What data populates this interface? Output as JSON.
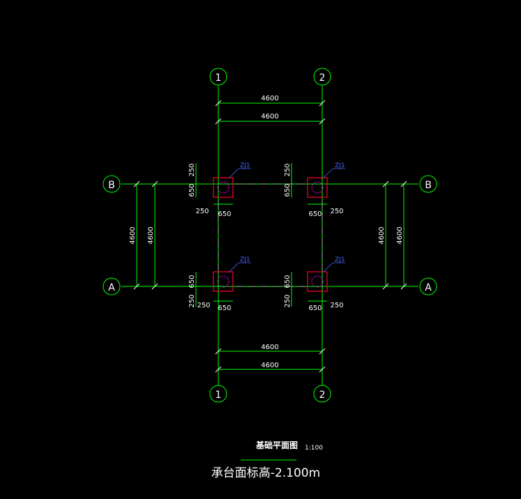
{
  "drawing": {
    "title": "基础平面图",
    "scale": "1:100",
    "subtitle": "承台面标高-2.100m",
    "colors": {
      "background": "#000000",
      "axis_line": "#00ff00",
      "grid_line": "#ffffff",
      "dimension": "#ffffff",
      "cap_outline": "#ff0033",
      "pile": "#ff00ff",
      "pile_label": "#4a6bff"
    }
  },
  "axes": {
    "columns": [
      {
        "id": "col-1",
        "label": "1"
      },
      {
        "id": "col-2",
        "label": "2"
      }
    ],
    "rows": [
      {
        "id": "row-B",
        "label": "B"
      },
      {
        "id": "row-A",
        "label": "A"
      }
    ]
  },
  "dimensions": {
    "top_outer": "4600",
    "top_inner": "4600",
    "bottom_inner": "4600",
    "bottom_outer": "4600",
    "left_outer": "4600",
    "left_inner": "4600",
    "right_inner": "4600",
    "right_outer": "4600"
  },
  "caps": [
    {
      "id": "cap-B1",
      "label": "ZJ1",
      "dim_a": "250",
      "dim_b": "650",
      "dim_c": "250",
      "dim_d": "650"
    },
    {
      "id": "cap-B2",
      "label": "ZJ1",
      "dim_a": "250",
      "dim_b": "650",
      "dim_c": "650",
      "dim_d": "250"
    },
    {
      "id": "cap-A1",
      "label": "ZJ1",
      "dim_a": "650",
      "dim_b": "250",
      "dim_c": "250",
      "dim_d": "650"
    },
    {
      "id": "cap-A2",
      "label": "ZJ1",
      "dim_a": "650",
      "dim_b": "250",
      "dim_c": "650",
      "dim_d": "250"
    }
  ]
}
